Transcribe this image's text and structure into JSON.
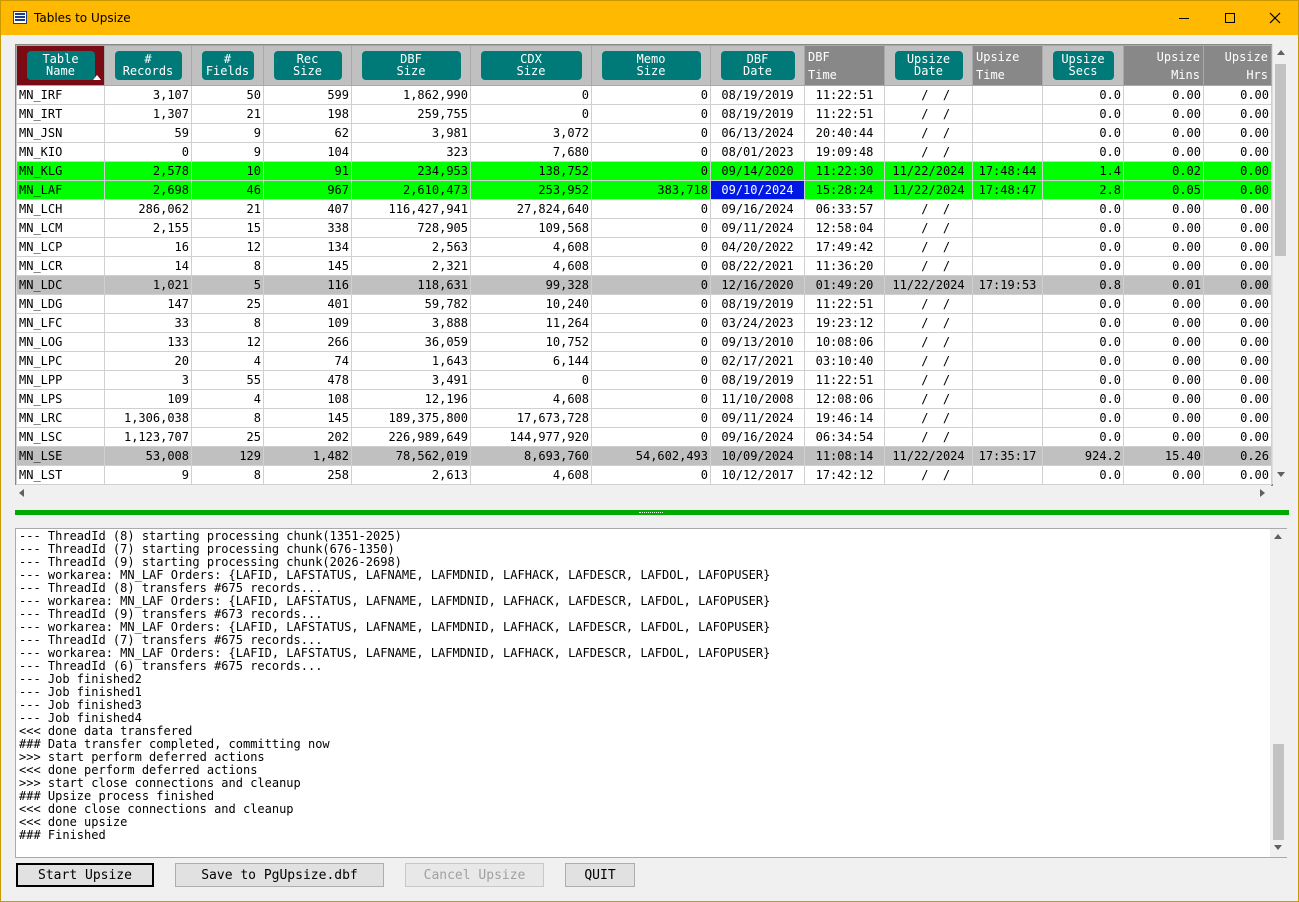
{
  "window": {
    "title": "Tables to Upsize"
  },
  "grid": {
    "columns": [
      {
        "label": "Table\nName",
        "style": "sorted",
        "align": "l",
        "width": 88
      },
      {
        "label": "#\nRecords",
        "style": "button",
        "align": "n",
        "width": 87
      },
      {
        "label": "#\nFields",
        "style": "button",
        "align": "n",
        "width": 72
      },
      {
        "label": "Rec\nSize",
        "style": "button",
        "align": "n",
        "width": 88
      },
      {
        "label": "DBF\nSize",
        "style": "button",
        "align": "n",
        "width": 119
      },
      {
        "label": "CDX\nSize",
        "style": "button",
        "align": "n",
        "width": 121
      },
      {
        "label": "Memo\nSize",
        "style": "button",
        "align": "n",
        "width": 119
      },
      {
        "label": "DBF\nDate",
        "style": "button",
        "align": "c",
        "width": 94
      },
      {
        "label": "DBF\nTime",
        "style": "plain-left",
        "align": "c",
        "width": 80
      },
      {
        "label": "Upsize\nDate",
        "style": "button",
        "align": "c",
        "width": 88
      },
      {
        "label": "Upsize\nTime",
        "style": "plain-left",
        "align": "c",
        "width": 70
      },
      {
        "label": "Upsize\nSecs",
        "style": "button",
        "align": "n",
        "width": 81
      },
      {
        "label": "Upsize\nMins",
        "style": "plain-right",
        "align": "n",
        "width": 80
      },
      {
        "label": "Upsize\nHrs",
        "style": "plain-right",
        "align": "n",
        "width": 68
      }
    ],
    "sorted_column": "Table Name",
    "rows": [
      {
        "hl": "",
        "cells": [
          "MN_IRF",
          "3,107",
          "50",
          "599",
          "1,862,990",
          "0",
          "0",
          "08/19/2019",
          "11:22:51",
          "  /  /",
          "",
          "0.0",
          "0.00",
          "0.00"
        ]
      },
      {
        "hl": "",
        "cells": [
          "MN_IRT",
          "1,307",
          "21",
          "198",
          "259,755",
          "0",
          "0",
          "08/19/2019",
          "11:22:51",
          "  /  /",
          "",
          "0.0",
          "0.00",
          "0.00"
        ]
      },
      {
        "hl": "",
        "cells": [
          "MN_JSN",
          "59",
          "9",
          "62",
          "3,981",
          "3,072",
          "0",
          "06/13/2024",
          "20:40:44",
          "  /  /",
          "",
          "0.0",
          "0.00",
          "0.00"
        ]
      },
      {
        "hl": "",
        "cells": [
          "MN_KIO",
          "0",
          "9",
          "104",
          "323",
          "7,680",
          "0",
          "08/01/2023",
          "19:09:48",
          "  /  /",
          "",
          "0.0",
          "0.00",
          "0.00"
        ]
      },
      {
        "hl": "green",
        "cells": [
          "MN_KLG",
          "2,578",
          "10",
          "91",
          "234,953",
          "138,752",
          "0",
          "09/14/2020",
          "11:22:30",
          "11/22/2024",
          "17:48:44",
          "1.4",
          "0.02",
          "0.00"
        ]
      },
      {
        "hl": "green",
        "sel": 7,
        "cells": [
          "MN_LAF",
          "2,698",
          "46",
          "967",
          "2,610,473",
          "253,952",
          "383,718",
          "09/10/2024",
          "15:28:24",
          "11/22/2024",
          "17:48:47",
          "2.8",
          "0.05",
          "0.00"
        ]
      },
      {
        "hl": "",
        "cells": [
          "MN_LCH",
          "286,062",
          "21",
          "407",
          "116,427,941",
          "27,824,640",
          "0",
          "09/16/2024",
          "06:33:57",
          "  /  /",
          "",
          "0.0",
          "0.00",
          "0.00"
        ]
      },
      {
        "hl": "",
        "cells": [
          "MN_LCM",
          "2,155",
          "15",
          "338",
          "728,905",
          "109,568",
          "0",
          "09/11/2024",
          "12:58:04",
          "  /  /",
          "",
          "0.0",
          "0.00",
          "0.00"
        ]
      },
      {
        "hl": "",
        "cells": [
          "MN_LCP",
          "16",
          "12",
          "134",
          "2,563",
          "4,608",
          "0",
          "04/20/2022",
          "17:49:42",
          "  /  /",
          "",
          "0.0",
          "0.00",
          "0.00"
        ]
      },
      {
        "hl": "",
        "cells": [
          "MN_LCR",
          "14",
          "8",
          "145",
          "2,321",
          "4,608",
          "0",
          "08/22/2021",
          "11:36:20",
          "  /  /",
          "",
          "0.0",
          "0.00",
          "0.00"
        ]
      },
      {
        "hl": "gray",
        "cells": [
          "MN_LDC",
          "1,021",
          "5",
          "116",
          "118,631",
          "99,328",
          "0",
          "12/16/2020",
          "01:49:20",
          "11/22/2024",
          "17:19:53",
          "0.8",
          "0.01",
          "0.00"
        ]
      },
      {
        "hl": "",
        "cells": [
          "MN_LDG",
          "147",
          "25",
          "401",
          "59,782",
          "10,240",
          "0",
          "08/19/2019",
          "11:22:51",
          "  /  /",
          "",
          "0.0",
          "0.00",
          "0.00"
        ]
      },
      {
        "hl": "",
        "cells": [
          "MN_LFC",
          "33",
          "8",
          "109",
          "3,888",
          "11,264",
          "0",
          "03/24/2023",
          "19:23:12",
          "  /  /",
          "",
          "0.0",
          "0.00",
          "0.00"
        ]
      },
      {
        "hl": "",
        "cells": [
          "MN_LOG",
          "133",
          "12",
          "266",
          "36,059",
          "10,752",
          "0",
          "09/13/2010",
          "10:08:06",
          "  /  /",
          "",
          "0.0",
          "0.00",
          "0.00"
        ]
      },
      {
        "hl": "",
        "cells": [
          "MN_LPC",
          "20",
          "4",
          "74",
          "1,643",
          "6,144",
          "0",
          "02/17/2021",
          "03:10:40",
          "  /  /",
          "",
          "0.0",
          "0.00",
          "0.00"
        ]
      },
      {
        "hl": "",
        "cells": [
          "MN_LPP",
          "3",
          "55",
          "478",
          "3,491",
          "0",
          "0",
          "08/19/2019",
          "11:22:51",
          "  /  /",
          "",
          "0.0",
          "0.00",
          "0.00"
        ]
      },
      {
        "hl": "",
        "cells": [
          "MN_LPS",
          "109",
          "4",
          "108",
          "12,196",
          "4,608",
          "0",
          "11/10/2008",
          "12:08:06",
          "  /  /",
          "",
          "0.0",
          "0.00",
          "0.00"
        ]
      },
      {
        "hl": "",
        "cells": [
          "MN_LRC",
          "1,306,038",
          "8",
          "145",
          "189,375,800",
          "17,673,728",
          "0",
          "09/11/2024",
          "19:46:14",
          "  /  /",
          "",
          "0.0",
          "0.00",
          "0.00"
        ]
      },
      {
        "hl": "",
        "cells": [
          "MN_LSC",
          "1,123,707",
          "25",
          "202",
          "226,989,649",
          "144,977,920",
          "0",
          "09/16/2024",
          "06:34:54",
          "  /  /",
          "",
          "0.0",
          "0.00",
          "0.00"
        ]
      },
      {
        "hl": "gray",
        "cells": [
          "MN_LSE",
          "53,008",
          "129",
          "1,482",
          "78,562,019",
          "8,693,760",
          "54,602,493",
          "10/09/2024",
          "11:08:14",
          "11/22/2024",
          "17:35:17",
          "924.2",
          "15.40",
          "0.26"
        ]
      },
      {
        "hl": "",
        "cells": [
          "MN_LST",
          "9",
          "8",
          "258",
          "2,613",
          "4,608",
          "0",
          "10/12/2017",
          "17:42:12",
          "  /  /",
          "",
          "0.0",
          "0.00",
          "0.00"
        ]
      }
    ]
  },
  "log": {
    "lines": [
      "--- ThreadId (8) starting processing chunk(1351-2025)",
      "--- ThreadId (7) starting processing chunk(676-1350)",
      "--- ThreadId (9) starting processing chunk(2026-2698)",
      "--- workarea: MN_LAF Orders: {LAFID, LAFSTATUS, LAFNAME, LAFMDNID, LAFHACK, LAFDESCR, LAFDOL, LAFOPUSER}",
      "--- ThreadId (8) transfers #675 records...",
      "--- workarea: MN_LAF Orders: {LAFID, LAFSTATUS, LAFNAME, LAFMDNID, LAFHACK, LAFDESCR, LAFDOL, LAFOPUSER}",
      "--- ThreadId (9) transfers #673 records...",
      "--- workarea: MN_LAF Orders: {LAFID, LAFSTATUS, LAFNAME, LAFMDNID, LAFHACK, LAFDESCR, LAFDOL, LAFOPUSER}",
      "--- ThreadId (7) transfers #675 records...",
      "--- workarea: MN_LAF Orders: {LAFID, LAFSTATUS, LAFNAME, LAFMDNID, LAFHACK, LAFDESCR, LAFDOL, LAFOPUSER}",
      "--- ThreadId (6) transfers #675 records...",
      "--- Job finished2",
      "--- Job finished1",
      "--- Job finished3",
      "--- Job finished4",
      "<<< done data transfered",
      "### Data transfer completed, committing now",
      ">>> start perform deferred actions",
      "<<< done perform deferred actions",
      ">>> start close connections and cleanup",
      "### Upsize process finished",
      "<<< done close connections and cleanup",
      "<<< done upsize",
      "### Finished"
    ]
  },
  "buttons": {
    "start": "Start Upsize",
    "save": "Save to PgUpsize.dbf",
    "cancel": "Cancel Upsize",
    "quit": "QUIT"
  },
  "icons": [
    "app-icon",
    "minimize-icon",
    "maximize-icon",
    "close-icon",
    "sort-ascending-icon"
  ],
  "colors": {
    "titlebar": "#ffb900",
    "header_button": "#007a78",
    "sorted_header": "#7a0a14",
    "row_green": "#00ff00",
    "row_gray": "#c0c0c0",
    "selected_cell": "#0018e6",
    "splitter": "#00aa00"
  }
}
